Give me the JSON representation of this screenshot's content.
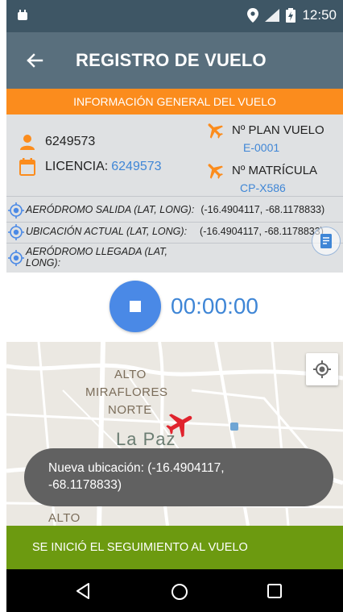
{
  "status_bar": {
    "time": "12:50"
  },
  "app_bar": {
    "title": "REGISTRO DE VUELO"
  },
  "section_header": "INFORMACIÓN GENERAL DEL VUELO",
  "info": {
    "user_id": "6249573",
    "license_label": "LICENCIA:",
    "license_value": "6249573",
    "plan_label": "Nº PLAN VUELO",
    "plan_value": "E-0001",
    "matricula_label": "Nº MATRÍCULA",
    "matricula_value": "CP-X586"
  },
  "coordinates": [
    {
      "label": "AERÓDROMO SALIDA (LAT, LONG):",
      "value": "(-16.4904117, -68.1178833)"
    },
    {
      "label": "UBICACIÓN ACTUAL (LAT, LONG):",
      "value": "(-16.4904117, -68.1178833)"
    },
    {
      "label_line1": "AERÓDROMO LLEGADA (LAT,",
      "label_line2": "LONG):",
      "value": ""
    }
  ],
  "timer": {
    "value": "00:00:00"
  },
  "map": {
    "labels": [
      "ALTO",
      "MIRAFLORES",
      "NORTE",
      "La Paz",
      "ALTO"
    ]
  },
  "toast": {
    "line1": "Nueva ubicación: (-16.4904117,",
    "line2": "-68.1178833)"
  },
  "footer_message": "SE INICIÓ EL SEGUIMIENTO AL VUELO",
  "colors": {
    "status_bar": "#3e5665",
    "app_bar": "#596f7d",
    "orange": "#fb8c1d",
    "blue": "#3f86d6",
    "green": "#6c9a10",
    "plane_red": "#e0232d"
  },
  "icons": {
    "back": "arrow-left-icon",
    "person": "person-icon",
    "calendar": "calendar-icon",
    "plane": "airplane-icon",
    "location": "location-target-icon",
    "document": "document-icon",
    "stop": "stop-icon",
    "my_location": "my-location-icon"
  }
}
